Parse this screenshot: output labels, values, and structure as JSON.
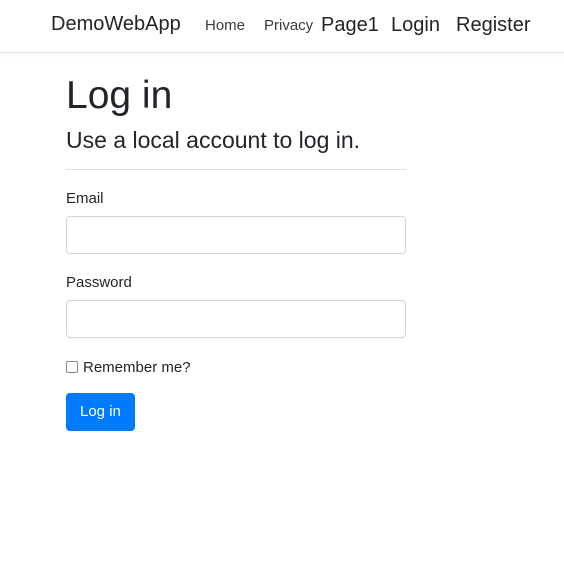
{
  "navbar": {
    "brand": "DemoWebApp",
    "links": {
      "home": "Home",
      "privacy": "Privacy",
      "page1": "Page1",
      "login": "Login",
      "register": "Register"
    }
  },
  "form": {
    "title": "Log in",
    "subtitle": "Use a local account to log in.",
    "email_label": "Email",
    "email_value": "",
    "password_label": "Password",
    "password_value": "",
    "remember_label": "Remember me?",
    "remember_checked": false,
    "submit_label": "Log in"
  },
  "colors": {
    "primary": "#007bff",
    "text": "#212529",
    "border": "#ced4da"
  }
}
